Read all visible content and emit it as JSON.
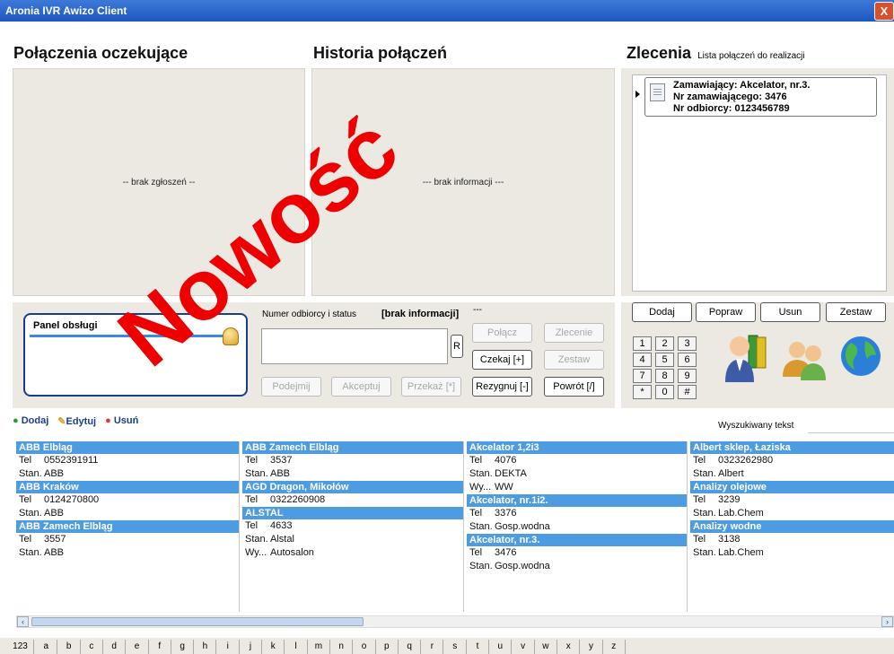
{
  "app": {
    "title": "Aronia IVR Awizo Client",
    "close": "X"
  },
  "waiting": {
    "title": "Połączenia oczekujące",
    "empty": "-- brak zgłoszeń --"
  },
  "history": {
    "title": "Historia połączeń",
    "empty": "--- brak informacji ---"
  },
  "orders": {
    "title": "Zlecenia",
    "subtitle": "Lista połączeń do realizacji",
    "item": {
      "line1": "Zamawiający: Akcelator, nr.3.",
      "line2": "Nr zamawiającego: 3476",
      "line3": "Nr odbiorcy: 0123456789"
    },
    "buttons": [
      "Dodaj",
      "Popraw",
      "Usun",
      "Zestaw"
    ]
  },
  "watermark": "Nowość",
  "service_panel": {
    "title": "Panel obsługi"
  },
  "recipient": {
    "label": "Numer odbiorcy i status",
    "status": "[brak informacji]",
    "extra": "---",
    "r_button": "R"
  },
  "call_buttons": {
    "polacz": "Połącz",
    "zlecenie": "Zlecenie",
    "czekaj": "Czekaj [+]",
    "zestaw": "Zestaw",
    "podejmij": "Podejmij",
    "akceptuj": "Akceptuj",
    "przekaz": "Przekaż [*]",
    "rezygnuj": "Rezygnuj [-]",
    "powrot": "Powrót [/]"
  },
  "keypad": [
    [
      "1",
      "2",
      "3"
    ],
    [
      "4",
      "5",
      "6"
    ],
    [
      "7",
      "8",
      "9"
    ],
    [
      "*",
      "0",
      "#"
    ]
  ],
  "toolbar": {
    "add": "Dodaj",
    "edit": "Edytuj",
    "delete": "Usuń",
    "search_label": "Wyszukiwany tekst",
    "search_value": ""
  },
  "contacts": [
    [
      {
        "name": "ABB Elbląg",
        "lines": [
          [
            "Tel",
            "0552391911"
          ],
          [
            "Stan.",
            "ABB"
          ]
        ]
      },
      {
        "name": "ABB Kraków",
        "lines": [
          [
            "Tel",
            "0124270800"
          ],
          [
            "Stan.",
            "ABB"
          ]
        ]
      },
      {
        "name": "ABB Zamech Elbląg",
        "lines": [
          [
            "Tel",
            "3557"
          ],
          [
            "Stan.",
            "ABB"
          ]
        ]
      }
    ],
    [
      {
        "name": "ABB Zamech Elbląg",
        "lines": [
          [
            "Tel",
            "3537"
          ],
          [
            "Stan.",
            "ABB"
          ]
        ]
      },
      {
        "name": "AGD Dragon, Mikołów",
        "lines": [
          [
            "Tel",
            "0322260908"
          ]
        ]
      },
      {
        "name": "ALSTAL",
        "lines": [
          [
            "Tel",
            "4633"
          ],
          [
            "Stan.",
            "Alstal"
          ],
          [
            "Wy...",
            "Autosalon"
          ]
        ]
      }
    ],
    [
      {
        "name": "Akcelator 1,2i3",
        "lines": [
          [
            "Tel",
            "4076"
          ],
          [
            "Stan.",
            "DEKTA"
          ],
          [
            "Wy...",
            "WW"
          ]
        ]
      },
      {
        "name": "Akcelator, nr.1i2.",
        "lines": [
          [
            "Tel",
            "3376"
          ],
          [
            "Stan.",
            "Gosp.wodna"
          ]
        ]
      },
      {
        "name": "Akcelator, nr.3.",
        "lines": [
          [
            "Tel",
            "3476"
          ],
          [
            "Stan.",
            "Gosp.wodna"
          ]
        ]
      }
    ],
    [
      {
        "name": "Albert sklep, Łaziska",
        "lines": [
          [
            "Tel",
            "0323262980"
          ],
          [
            "Stan.",
            "Albert"
          ]
        ]
      },
      {
        "name": "Analizy olejowe",
        "lines": [
          [
            "Tel",
            "3239"
          ],
          [
            "Stan.",
            "Lab.Chem"
          ]
        ]
      },
      {
        "name": "Analizy wodne",
        "lines": [
          [
            "Tel",
            "3138"
          ],
          [
            "Stan.",
            "Lab.Chem"
          ]
        ]
      }
    ]
  ],
  "alphabet": [
    "123",
    "a",
    "b",
    "c",
    "d",
    "e",
    "f",
    "g",
    "h",
    "i",
    "j",
    "k",
    "l",
    "m",
    "n",
    "o",
    "p",
    "q",
    "r",
    "s",
    "t",
    "u",
    "v",
    "w",
    "x",
    "y",
    "z"
  ]
}
